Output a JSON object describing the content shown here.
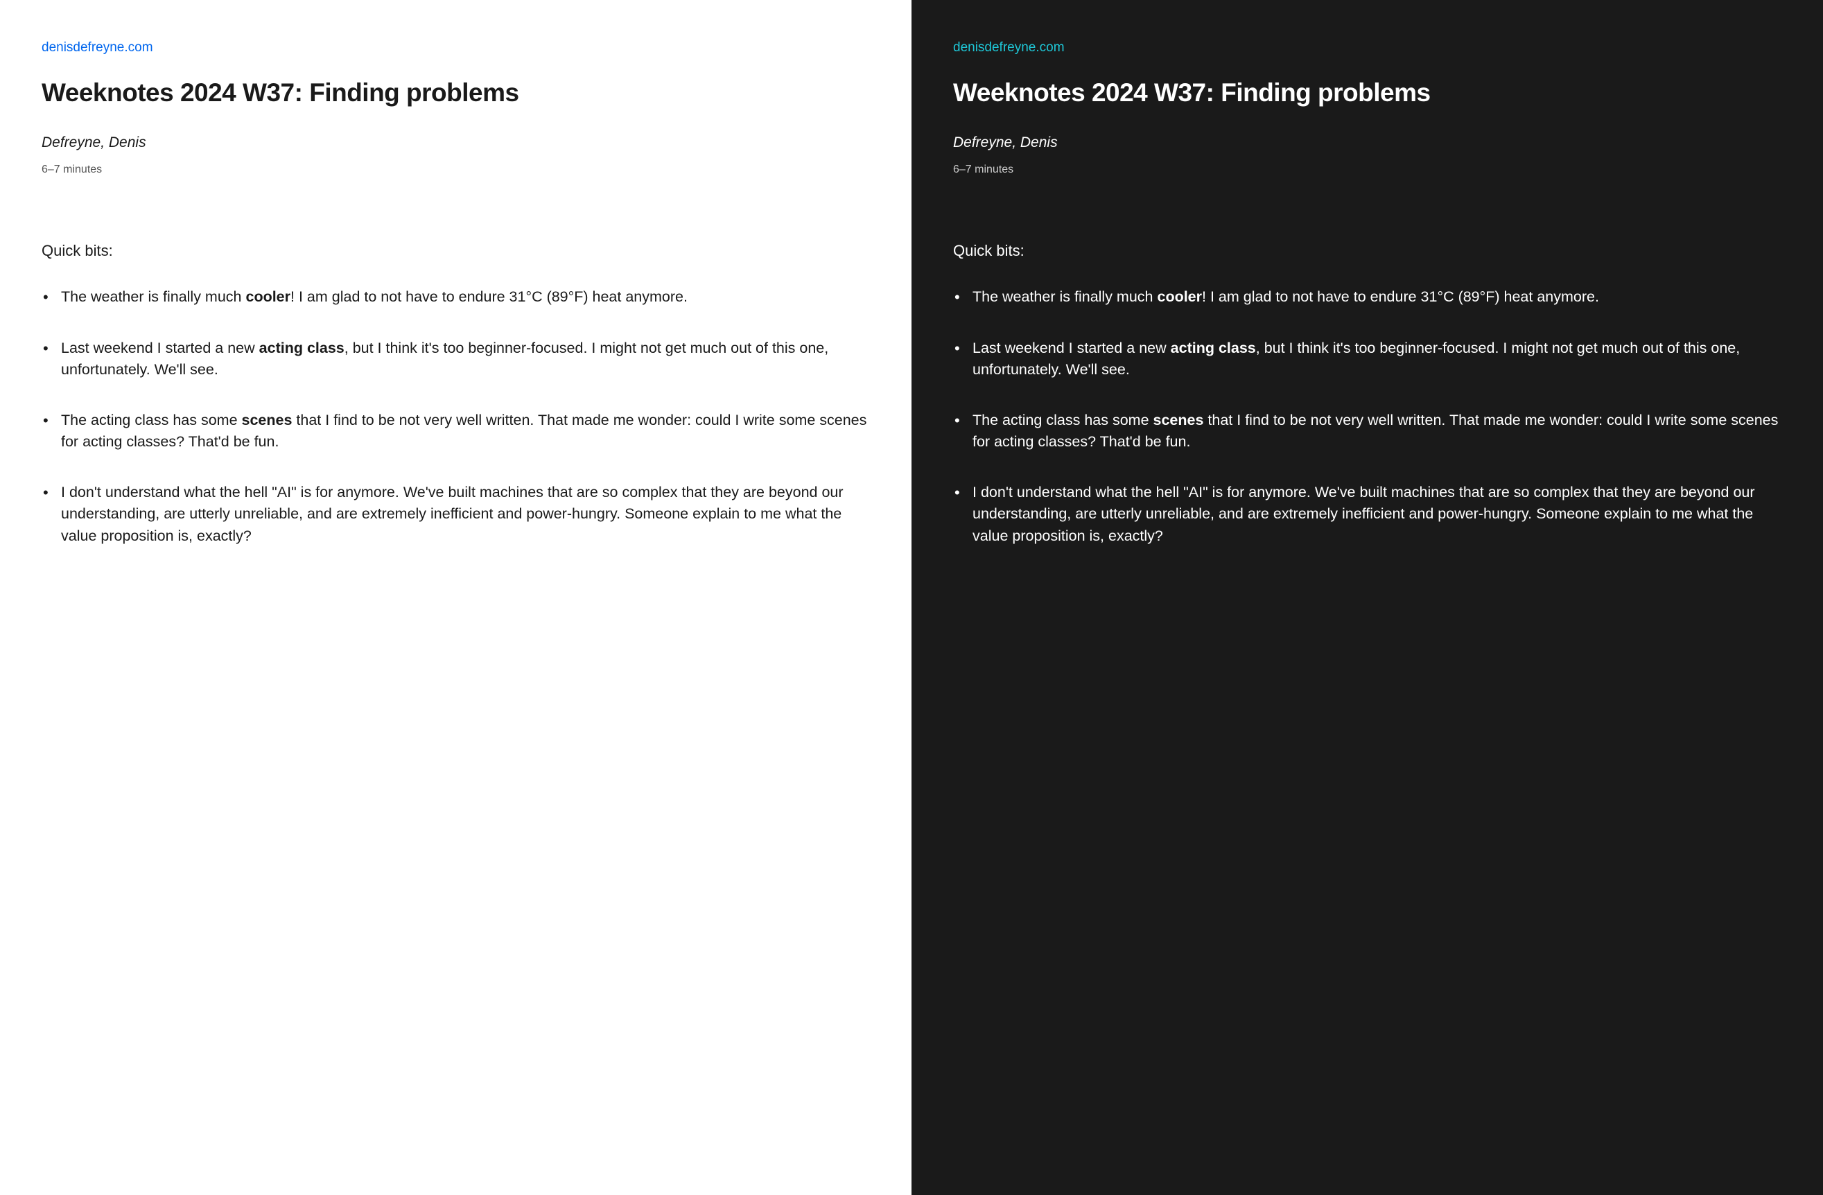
{
  "site_link": "denisdefreyne.com",
  "title": "Weeknotes 2024 W37: Finding problems",
  "author": "Defreyne, Denis",
  "read_time": "6–7 minutes",
  "intro": "Quick bits:",
  "bullets": [
    {
      "segments": [
        {
          "text": "The weather is finally much ",
          "bold": false
        },
        {
          "text": "cooler",
          "bold": true
        },
        {
          "text": "! I am glad to not have to endure 31°C (89°F) heat anymore.",
          "bold": false
        }
      ]
    },
    {
      "segments": [
        {
          "text": "Last weekend I started a new ",
          "bold": false
        },
        {
          "text": "acting class",
          "bold": true
        },
        {
          "text": ", but I think it's too beginner-focused. I might not get much out of this one, unfortunately. We'll see.",
          "bold": false
        }
      ]
    },
    {
      "segments": [
        {
          "text": "The acting class has some ",
          "bold": false
        },
        {
          "text": "scenes",
          "bold": true
        },
        {
          "text": " that I find to be not very well written. That made me wonder: could I write some scenes for acting classes? That'd be fun.",
          "bold": false
        }
      ]
    },
    {
      "segments": [
        {
          "text": "I don't understand what the hell \"AI\" is for anymore. We've built machines that are so complex that they are beyond our understanding, are utterly unreliable, and are extremely inefficient and power-hungry. Someone explain to me what the value proposition is, exactly?",
          "bold": false
        }
      ]
    }
  ]
}
